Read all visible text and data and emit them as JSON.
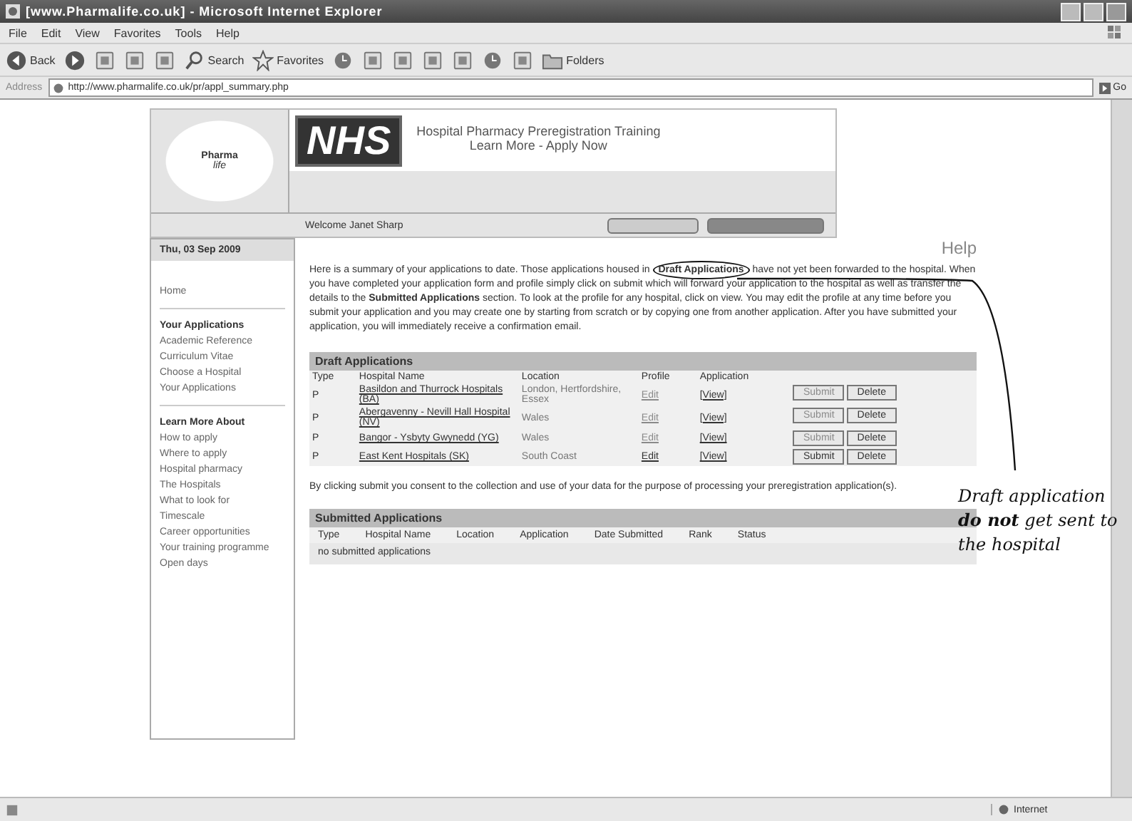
{
  "window": {
    "title": "[www.Pharmalife.co.uk] - Microsoft Internet Explorer"
  },
  "menu": [
    "File",
    "Edit",
    "View",
    "Favorites",
    "Tools",
    "Help"
  ],
  "toolbar": [
    {
      "kind": "back",
      "label": "Back"
    },
    {
      "kind": "forward"
    },
    {
      "kind": "stop"
    },
    {
      "kind": "refresh"
    },
    {
      "kind": "home"
    },
    {
      "kind": "search",
      "label": "Search"
    },
    {
      "kind": "favorites",
      "label": "Favorites"
    },
    {
      "kind": "history"
    },
    {
      "kind": "mail"
    },
    {
      "kind": "print"
    },
    {
      "kind": "edit"
    },
    {
      "kind": "discuss"
    },
    {
      "kind": "messenger"
    },
    {
      "kind": "media"
    },
    {
      "kind": "folders",
      "label": "Folders"
    }
  ],
  "address": {
    "label": "Address",
    "value": "http://www.pharmalife.co.uk/pr/appl_summary.php",
    "go": "Go"
  },
  "header": {
    "logo_top": "Pharma",
    "logo_bottom": "life",
    "nhs": "NHS",
    "title": "Hospital Pharmacy Preregistration Training",
    "subtitle": "Learn More - Apply Now",
    "welcome": "Welcome Janet Sharp"
  },
  "sidebar": {
    "date": "Thu, 03 Sep 2009",
    "sections": [
      {
        "items": [
          "Home"
        ]
      },
      {
        "heading": "Your Applications",
        "items": [
          "Academic Reference",
          "Curriculum Vitae",
          "Choose a Hospital",
          "Your Applications"
        ]
      },
      {
        "heading": "Learn More About",
        "items": [
          "How to apply",
          "Where to apply",
          "Hospital pharmacy",
          "The Hospitals",
          "What to look for",
          "Timescale",
          "Career opportunities",
          "Your training programme",
          "Open days"
        ]
      }
    ]
  },
  "help": "Help",
  "intro": "Here is a summary of your applications to date. Those applications housed in **Draft Applications** have not yet been forwarded to the hospital. When you have completed your application form and profile simply click on submit which will forward your application to the hospital as well as transfer the details to the **Submitted Applications** section. To look at the profile for any hospital, click on view. You may edit the profile at any time before you submit your application and you may create one by starting from scratch or by copying one from another application. After you have submitted your application, you will immediately receive a confirmation email.",
  "draft": {
    "title": "Draft Applications",
    "columns": [
      "Type",
      "Hospital Name",
      "Location",
      "Profile",
      "Application"
    ],
    "rows": [
      {
        "type": "P",
        "hospital": "Basildon and Thurrock Hospitals (BA)",
        "location": "London, Hertfordshire, Essex",
        "profile": "Edit",
        "application": "[View]",
        "submit": "Submit",
        "delete": "Delete",
        "disabled": true
      },
      {
        "type": "P",
        "hospital": "Abergavenny - Nevill Hall Hospital (NV)",
        "location": "Wales",
        "profile": "Edit",
        "application": "[View]",
        "submit": "Submit",
        "delete": "Delete",
        "disabled": true
      },
      {
        "type": "P",
        "hospital": "Bangor - Ysbyty Gwynedd (YG)",
        "location": "Wales",
        "profile": "Edit",
        "application": "[View]",
        "submit": "Submit",
        "delete": "Delete",
        "disabled": true
      },
      {
        "type": "P",
        "hospital": "East Kent Hospitals (SK)",
        "location": "South Coast",
        "profile": "Edit",
        "application": "[View]",
        "submit": "Submit",
        "delete": "Delete",
        "disabled": false
      }
    ]
  },
  "consent": "By clicking submit you consent to the collection and use of your data for the purpose of processing your preregistration application(s).",
  "submitted": {
    "title": "Submitted Applications",
    "columns": [
      "Type",
      "Hospital Name",
      "Location",
      "Application",
      "Date Submitted",
      "Rank",
      "Status"
    ],
    "empty": "no submitted applications"
  },
  "annotation": [
    "Draft application",
    "**do not** get sent to",
    "the hospital"
  ],
  "status_bar": {
    "zone": "Internet"
  }
}
